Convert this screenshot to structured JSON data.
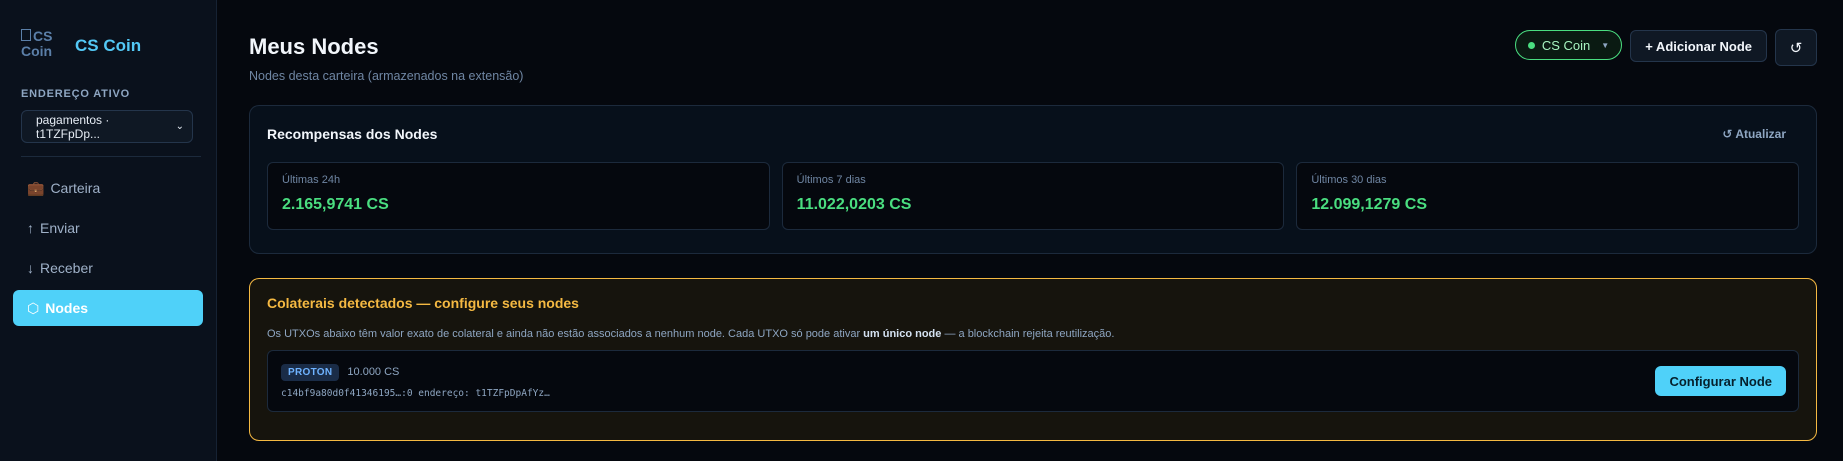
{
  "brand": {
    "logo_alt": "CS Coin",
    "name": "CS Coin"
  },
  "sidebar": {
    "address_label": "ENDEREÇO ATIVO",
    "address_selected": "pagamentos · t1TZFpDp...",
    "items": [
      {
        "icon": "💼",
        "label": "Carteira"
      },
      {
        "icon": "↑",
        "label": "Enviar"
      },
      {
        "icon": "↓",
        "label": "Receber"
      },
      {
        "icon": "⬡",
        "label": "Nodes"
      }
    ]
  },
  "header": {
    "title": "Meus Nodes",
    "subtitle": "Nodes desta carteira (armazenados na extensão)",
    "network": "CS Coin",
    "add_node": "+ Adicionar Node",
    "refresh_icon": "↺"
  },
  "rewards": {
    "title": "Recompensas dos Nodes",
    "update": "↺ Atualizar",
    "stats": [
      {
        "label": "Últimas 24h",
        "value": "2.165,9741 CS"
      },
      {
        "label": "Últimos 7 dias",
        "value": "11.022,0203 CS"
      },
      {
        "label": "Últimos 30 dias",
        "value": "12.099,1279 CS"
      }
    ]
  },
  "collateral": {
    "title": "Colaterais detectados — configure seus nodes",
    "desc_before": "Os UTXOs abaixo têm valor exato de colateral e ainda não estão associados a nenhum node. Cada UTXO só pode ativar ",
    "desc_bold": "um único node",
    "desc_after": " — a blockchain rejeita reutilização.",
    "utxo": {
      "tier": "PROTON",
      "amount": "10.000 CS",
      "meta": "c14bf9a80d0f41346195…:0 endereço: t1TZFpDpAfYz…",
      "button": "Configurar Node"
    }
  },
  "colors": {
    "accent": "#4fd1f9",
    "success": "#4ade80",
    "warning": "#f5b942",
    "background": "#05080e"
  }
}
